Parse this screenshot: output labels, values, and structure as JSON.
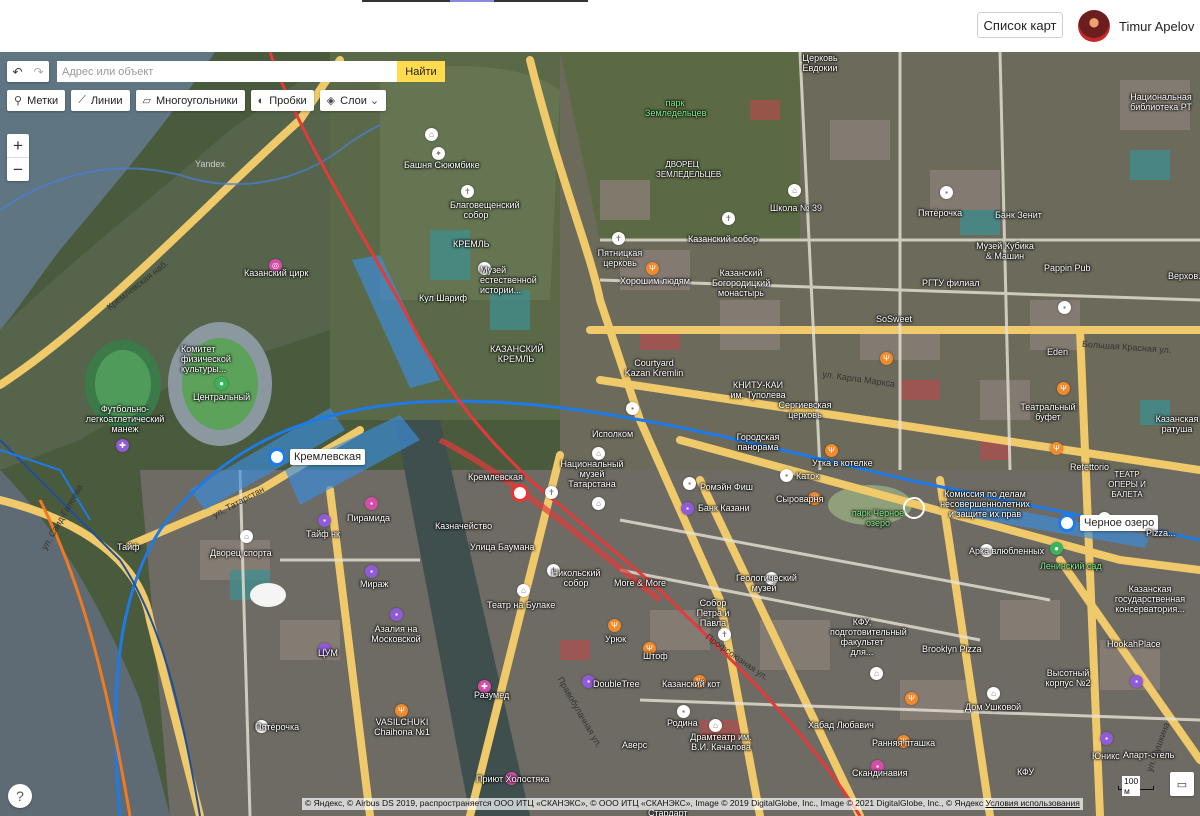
{
  "header": {
    "map_list_button": "Список карт",
    "user_name": "Timur Apelov"
  },
  "toolbar": {
    "search_placeholder": "Адрес или объект",
    "search_button": "Найти",
    "tools": [
      {
        "icon": "placemark-icon",
        "label": "Метки"
      },
      {
        "icon": "line-icon",
        "label": "Линии"
      },
      {
        "icon": "polygon-icon",
        "label": "Многоугольники"
      },
      {
        "icon": "traffic-icon",
        "label": "Пробки"
      },
      {
        "icon": "layers-icon",
        "label": "Слои"
      }
    ],
    "zoom_in": "+",
    "zoom_out": "−"
  },
  "map": {
    "stations": [
      {
        "name": "Кремлевская",
        "line_color": "#1e7ae6"
      },
      {
        "name": "Черное озеро",
        "line_color": "#1e7ae6"
      }
    ],
    "labels": {
      "circus": "Казанский цирк",
      "suyumbike": "Башня Сююмбике",
      "blagoveshchensky": "Благовещенский собор",
      "kremlin": "КРЕМЛЬ",
      "sharif": "Кул Шариф",
      "museum_nat": "Музей естественной истории...",
      "kazan_kremlin": "КАЗАНСКИЙ КРЕМЛЬ",
      "committee": "Комитет физической культуры...",
      "central": "Центральный",
      "football": "Футбольно-легкоатлетический манеж",
      "pyatnitskaya": "Пятницкая церковь",
      "khoroshim": "Хорошим людям",
      "kazan_sobor": "Казанский собор",
      "bogoroditsky": "Казанский Богородицкий монастырь",
      "school39": "Школа № 39",
      "park_zemledeltsev": "парк Земледельцев",
      "vdnh_zemledeltsev": "ДВОРЕЦ ЗЕМЛЕДЕЛЬЦЕВ",
      "pyaterochka_top": "Пятёрочка",
      "bank_zenit": "Банк Зенит",
      "kubik": "Музей Кубика & Машин",
      "pappin": "Pappin Pub",
      "rgtu": "РГТУ филиал",
      "sosweet": "SoSweet",
      "eden": "Eden",
      "courtyard": "Courtyard Kazan Kremlin",
      "kniga_kai": "КНИТУ-КАИ им. Туполева",
      "sergievskaya": "Сергиевская церковь",
      "teatral_bufet": "Театральный буфет",
      "kazan_ratusha": "Казанская ратуша",
      "ispolkom": "Исполком",
      "panorama": "Городская панорама",
      "utka": "Утка в котелке",
      "refettorio": "Refettorio",
      "nat_museum": "Национальный музей Татарстана",
      "romeyn_fish": "Ромэйн Фиш",
      "katok": "Каток",
      "syrovarnya": "Сыроварня",
      "park_cherne_ozero": "парк Черное озеро",
      "commission": "Комиссия по делам несовершеннолетних и защите их прав",
      "arka": "Арка влюбленных",
      "leninsky_sad": "Ленинский сад",
      "teatr_baleta": "ТЕАТР ОПЕРЫ И БАЛЕТА",
      "kremlevskaya_area": "Кремлевская",
      "kaznacheystvo": "Казначейство",
      "ulitsa_baumana": "Улица Баумана",
      "nikolsky": "Никольский собор",
      "bank_kazani": "Банк Казани",
      "more_more": "More & More",
      "geolog": "Геологический музей",
      "petra_pavla": "Собор Петра и Павла",
      "kfu": "КФУ, подготовительный факультет для...",
      "brooklyn": "Brooklyn Pizza",
      "hookahplace": "HookahPlace",
      "konservatoriya": "Казанская государственная консерватория...",
      "pizza": "Pizza...",
      "piramida": "Пирамида",
      "tayf": "Тайф нк",
      "dvorec_sporta": "Дворец спорта",
      "mirazh": "Мираж",
      "azalia": "Азалия на Московской",
      "tsum": "ЦУМ",
      "teatr_bulake": "Театр на Булаке",
      "uryuk": "Урюк",
      "shtof": "Штоф",
      "doubletree": "DoubleTree",
      "kazansky_kot": "Казанский кот",
      "razumed": "Разумед",
      "rodina": "Родина",
      "dramteatr": "Драмтеатр им. В.И. Качалова",
      "avers": "Аверс",
      "habad": "Хабад Любавич",
      "rannyaya": "Ранняя пташка",
      "skandinaviya": "Скандинавия",
      "dom_ushkovoy": "Дом Ушковой",
      "vysotny": "Высотный корпус №2",
      "unics": "Юникс",
      "apart": "Апарт-отель",
      "kfu_bottom": "КФУ",
      "vasilchuki": "VASILCHUKI Chaihona №1",
      "pyaterochka_bottom": "Пятёрочка",
      "priyut": "Приют Холостяка",
      "stardart": "Стардарт",
      "tayf_bottom": "Тайф",
      "natsbiblioteka": "Национальная библиотека РТ",
      "tserkov_evdokii": "Церковь Евдокии",
      "verkhov": "Верхов...",
      "st_karla_marksa": "ул. Карла Маркса",
      "st_bolshaya_krasnaya": "Большая Красная ул.",
      "st_tatarstan": "ул. Татарстан",
      "st_kremlevskaya": "Кремлевская наб.",
      "st_said_galeeva": "ул. Саид-Галеева",
      "st_pushkina": "ул. Пушкина",
      "st_profsoyuznaya": "Профсоюзная ул.",
      "st_bulachnaya": "Правобулачная ул.",
      "yandex_watermark": "Yandex"
    }
  },
  "footer": {
    "copyright": "© Яндекс, © Airbus DS 2019, распространяется ООО ИТЦ «СКАНЭКС», © ООО ИТЦ «СКАНЭКС», Image © 2019 DigitalGlobe, Inc., Image © 2021 DigitalGlobe, Inc., © Яндекс",
    "terms_link": "Условия использования",
    "scale": "100 м",
    "help": "?"
  }
}
